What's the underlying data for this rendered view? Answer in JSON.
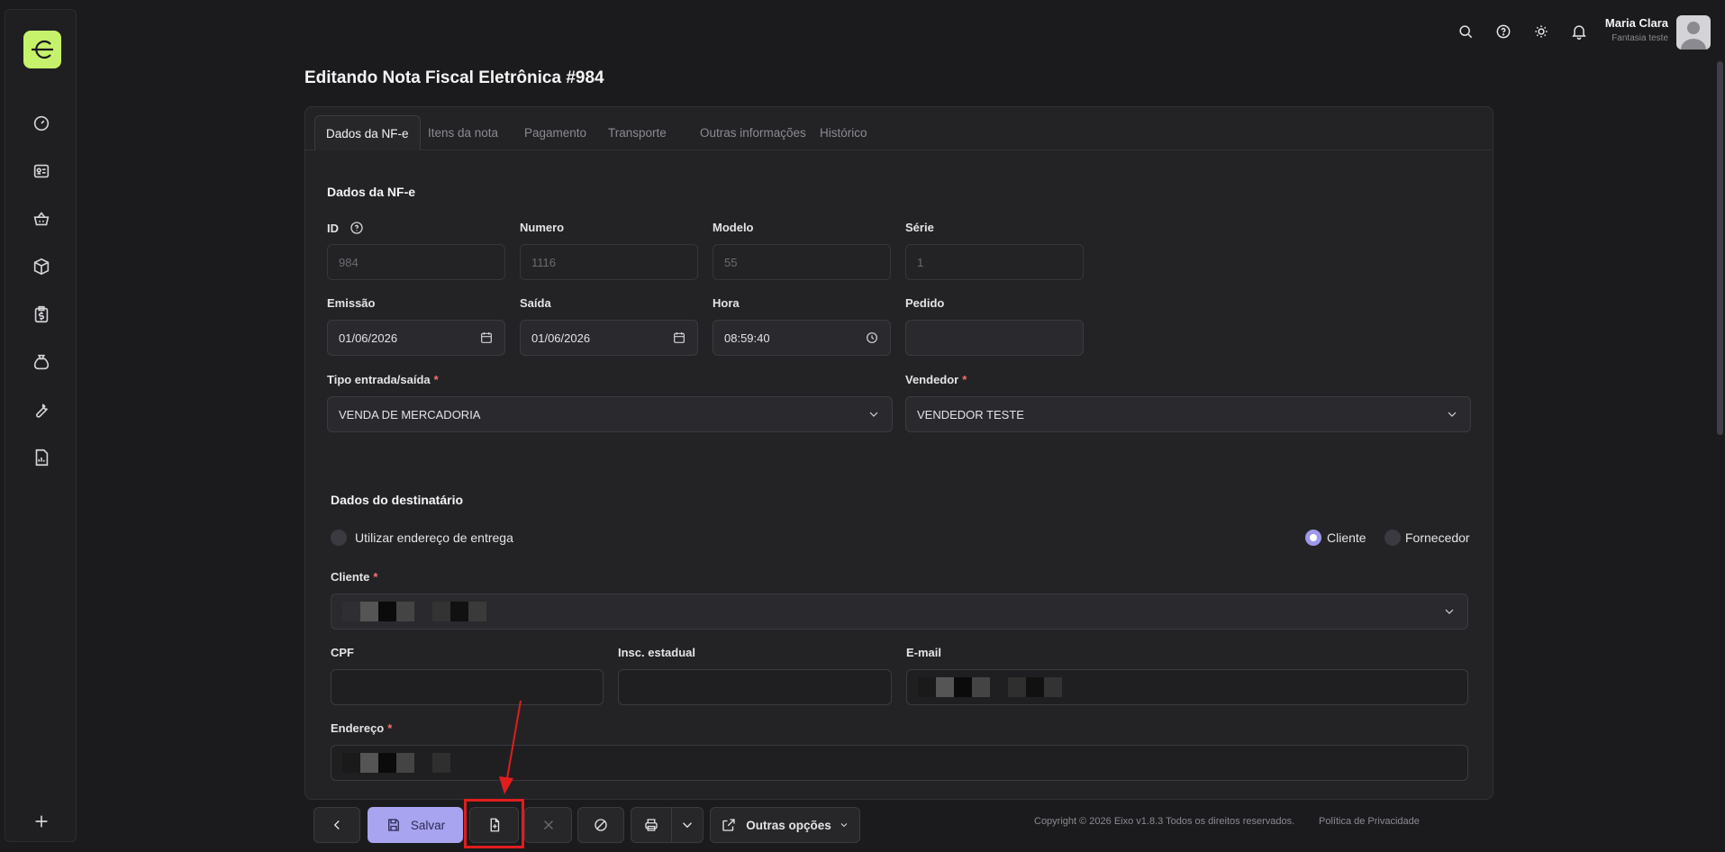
{
  "user": {
    "name": "Maria Clara",
    "subtitle": "Fantasia teste"
  },
  "page": {
    "title": "Editando Nota Fiscal Eletrônica #984"
  },
  "tabs": [
    {
      "label": "Dados da NF-e"
    },
    {
      "label": "Itens da nota"
    },
    {
      "label": "Pagamento"
    },
    {
      "label": "Transporte"
    },
    {
      "label": "Outras informações"
    },
    {
      "label": "Histórico"
    }
  ],
  "nfe": {
    "section_title": "Dados da NF-e",
    "id": {
      "label": "ID",
      "value": "984"
    },
    "numero": {
      "label": "Numero",
      "value": "1116"
    },
    "modelo": {
      "label": "Modelo",
      "value": "55"
    },
    "serie": {
      "label": "Série",
      "value": "1"
    },
    "emissao": {
      "label": "Emissão",
      "value": "01/06/2026"
    },
    "saida": {
      "label": "Saída",
      "value": "01/06/2026"
    },
    "hora": {
      "label": "Hora",
      "value": "08:59:40"
    },
    "pedido": {
      "label": "Pedido",
      "value": ""
    },
    "tipo": {
      "label": "Tipo entrada/saída",
      "value": "VENDA DE MERCADORIA"
    },
    "vendedor": {
      "label": "Vendedor",
      "value": "VENDEDOR TESTE"
    }
  },
  "destinatario": {
    "section_title": "Dados do destinatário",
    "use_delivery_address": "Utilizar endereço de entrega",
    "radio_cliente": "Cliente",
    "radio_fornecedor": "Fornecedor",
    "cliente_label": "Cliente",
    "cpf_label": "CPF",
    "ie_label": "Insc. estadual",
    "email_label": "E-mail",
    "endereco_label": "Endereço"
  },
  "toolbar": {
    "save_label": "Salvar",
    "other_options_label": "Outras opções"
  },
  "footer": {
    "copyright": "Copyright © 2026 Eixo v1.8.3 Todos os direitos reservados.",
    "privacy": "Política de Privacidade"
  },
  "colors": {
    "accent": "#a9a4f0",
    "brand": "#c5f26a",
    "highlight": "#e11d1d"
  },
  "icons": [
    "dashboard-icon",
    "contact-card-icon",
    "basket-icon",
    "box-icon",
    "clipboard-dollar-icon",
    "money-bag-icon",
    "wrench-icon",
    "report-icon",
    "plus-icon",
    "search-icon",
    "help-icon",
    "sun-icon",
    "bell-icon"
  ]
}
